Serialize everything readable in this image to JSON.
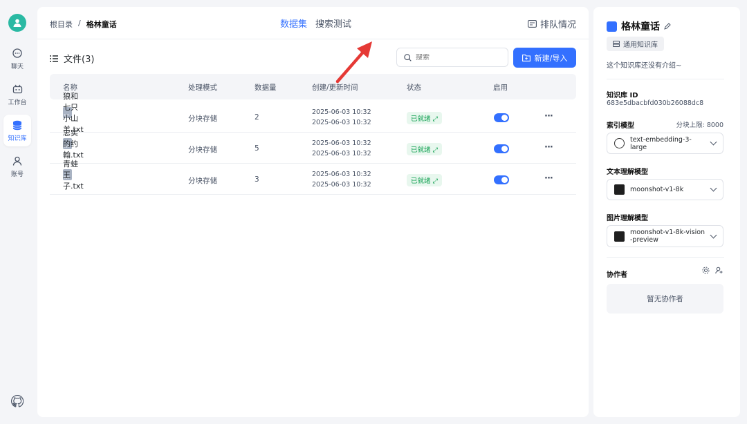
{
  "nav": {
    "items": [
      {
        "label": "聊天"
      },
      {
        "label": "工作台"
      },
      {
        "label": "知识库"
      },
      {
        "label": "账号"
      }
    ]
  },
  "topbar": {
    "breadcrumb_root": "根目录",
    "breadcrumb_sep": "/",
    "breadcrumb_current": "格林童话",
    "tabs": [
      {
        "label": "数据集"
      },
      {
        "label": "搜索测试"
      }
    ],
    "queue_label": "排队情况"
  },
  "files": {
    "title": "文件(3)",
    "search_placeholder": "搜索",
    "new_label": "新建/导入",
    "columns": [
      "名称",
      "处理模式",
      "数据量",
      "创建/更新时间",
      "状态",
      "启用"
    ],
    "rows": [
      {
        "name": "狼和七只小山羊.txt",
        "mode": "分块存储",
        "count": "2",
        "created": "2025-06-03 10:32",
        "updated": "2025-06-03 10:32",
        "status": "已就绪",
        "more": "···"
      },
      {
        "name": "忠实的约翰.txt",
        "mode": "分块存储",
        "count": "5",
        "created": "2025-06-03 10:32",
        "updated": "2025-06-03 10:32",
        "status": "已就绪",
        "more": "···"
      },
      {
        "name": "青蛙王子.txt",
        "mode": "分块存储",
        "count": "3",
        "created": "2025-06-03 10:32",
        "updated": "2025-06-03 10:32",
        "status": "已就绪",
        "more": "···"
      }
    ]
  },
  "side": {
    "title": "格林童话",
    "tag": "通用知识库",
    "intro": "这个知识库还没有介绍~",
    "id_label": "知识库 ID",
    "id_value": "683e5dbacbfd030b26088dc8",
    "index_label": "索引模型",
    "index_limit": "分块上限: 8000",
    "index_model": "text-embedding-3-large",
    "text_label": "文本理解模型",
    "text_model": "moonshot-v1-8k",
    "image_label": "图片理解模型",
    "image_model": "moonshot-v1-8k-vision-preview",
    "collab_label": "协作者",
    "collab_empty": "暂无协作者"
  },
  "colors": {
    "accent": "#3370ff",
    "ready": "#12a152",
    "arrow": "#e53935"
  }
}
